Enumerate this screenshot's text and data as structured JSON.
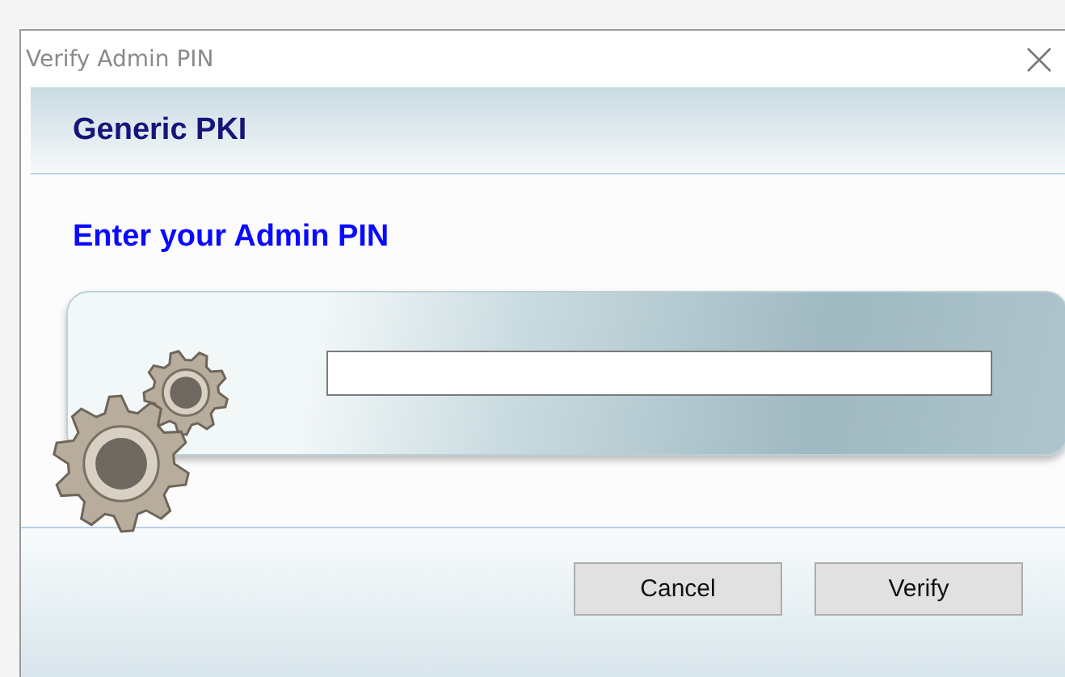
{
  "window": {
    "title": "Verify Admin PIN"
  },
  "header": {
    "title": "Generic PKI"
  },
  "prompt": "Enter your Admin PIN",
  "buttons": [
    "Cancel",
    "Verify"
  ]
}
